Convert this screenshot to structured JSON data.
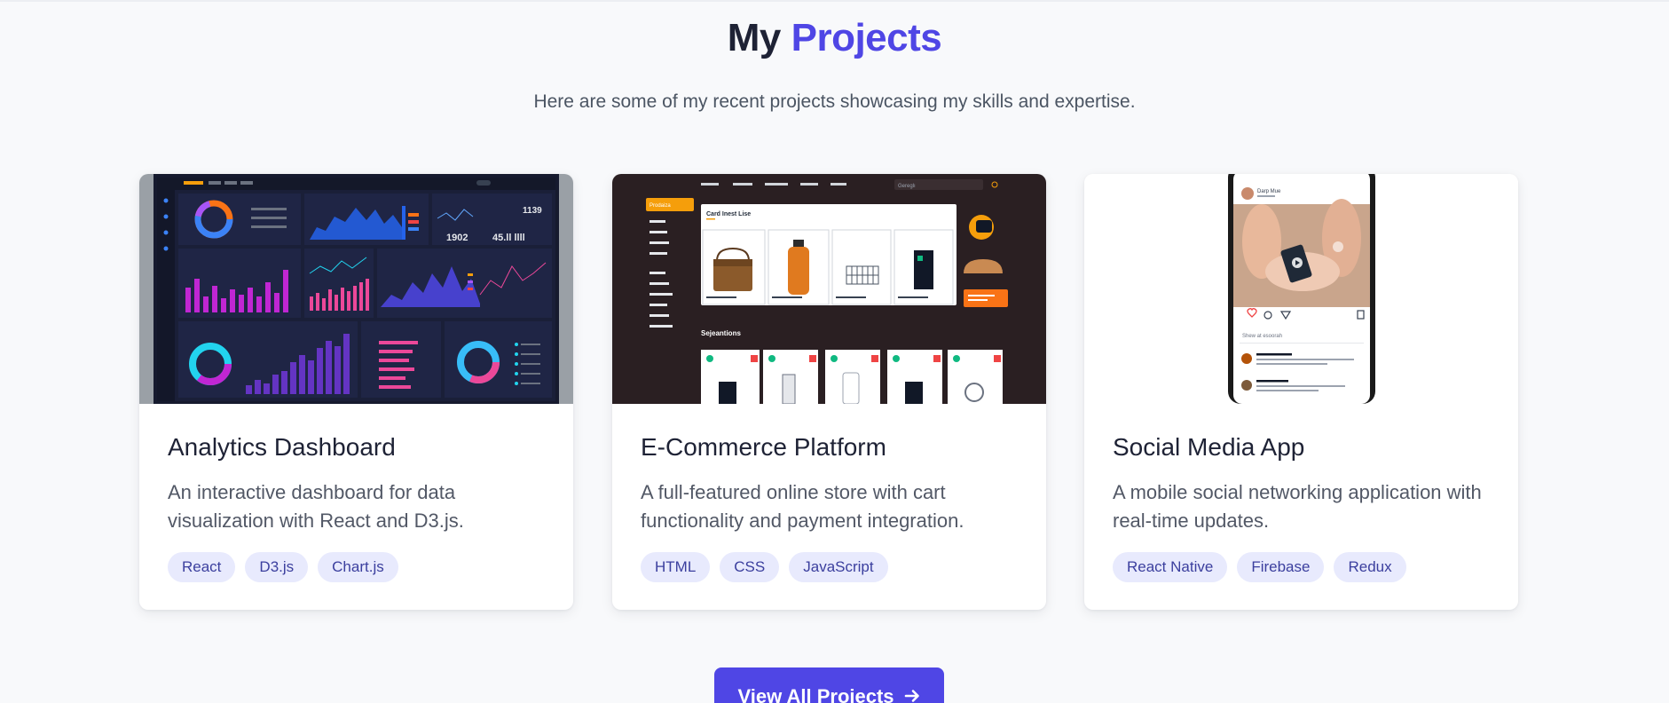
{
  "header": {
    "title_prefix": "My",
    "title_accent": "Projects",
    "subtitle": "Here are some of my recent projects showcasing my skills and expertise."
  },
  "projects": [
    {
      "title": "Analytics Dashboard",
      "description": "An interactive dashboard for data visualization with React and D3.js.",
      "tags": [
        "React",
        "D3.js",
        "Chart.js"
      ],
      "thumbnail_alt": "analytics-dashboard-screenshot",
      "thumbnail_text": {
        "kpi_1": "1902",
        "kpi_2": "45.ll llll",
        "kpi_3": "1139"
      }
    },
    {
      "title": "E-Commerce Platform",
      "description": "A full-featured online store with cart functionality and payment integration.",
      "tags": [
        "HTML",
        "CSS",
        "JavaScript"
      ],
      "thumbnail_alt": "ecommerce-store-screenshot",
      "thumbnail_text": {
        "nav_search": "Gereglı",
        "list_title": "Card Inest Lise",
        "section_title": "Sejeantions",
        "sidebar_active": "Prodaiza"
      }
    },
    {
      "title": "Social Media App",
      "description": "A mobile social networking application with real-time updates.",
      "tags": [
        "React Native",
        "Firebase",
        "Redux"
      ],
      "thumbnail_alt": "social-media-app-phone-mockup",
      "thumbnail_text": {
        "username": "Darp Mue",
        "comment_placeholder": "Shew at esoorah"
      }
    }
  ],
  "cta": {
    "label": "View All Projects",
    "icon": "arrow-right-icon"
  },
  "colors": {
    "accent": "#4f46e5",
    "tag_bg": "#e8eafd",
    "tag_text": "#3b3f9e",
    "page_bg": "#f8f9fb"
  }
}
